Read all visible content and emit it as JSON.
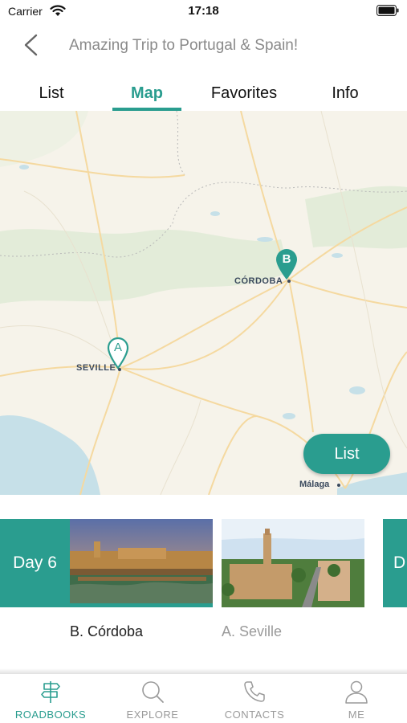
{
  "status_bar": {
    "carrier": "Carrier",
    "time": "17:18"
  },
  "header": {
    "back_icon": "chevron-left-icon",
    "title": "Amazing Trip to Portugal & Spain!"
  },
  "tabs": [
    {
      "label": "List",
      "active": false
    },
    {
      "label": "Map",
      "active": true
    },
    {
      "label": "Favorites",
      "active": false
    },
    {
      "label": "Info",
      "active": false
    }
  ],
  "map": {
    "cities": [
      {
        "name": "CÓRDOBA"
      },
      {
        "name": "SEVILLE"
      },
      {
        "name": "Málaga"
      }
    ],
    "markers": [
      {
        "letter": "B",
        "style": "filled"
      },
      {
        "letter": "A",
        "style": "outlined"
      }
    ],
    "list_button_label": "List"
  },
  "stops": {
    "day_label": "Day 6",
    "next_day_label": "D",
    "cards": [
      {
        "label": "B. Córdoba",
        "selected": true
      },
      {
        "label": "A. Seville",
        "selected": false
      }
    ]
  },
  "tab_bar": [
    {
      "label": "ROADBOOKS",
      "icon": "signpost-icon",
      "active": true
    },
    {
      "label": "EXPLORE",
      "icon": "search-icon",
      "active": false
    },
    {
      "label": "CONTACTS",
      "icon": "phone-icon",
      "active": false
    },
    {
      "label": "ME",
      "icon": "person-icon",
      "active": false
    }
  ],
  "colors": {
    "accent": "#2a9d8f",
    "inactive_text": "#9a9a9a",
    "map_land": "#f6f3ea",
    "map_water": "#c6e0e8",
    "map_green": "#e3ecd9",
    "map_roads": "#f5d9a0"
  }
}
